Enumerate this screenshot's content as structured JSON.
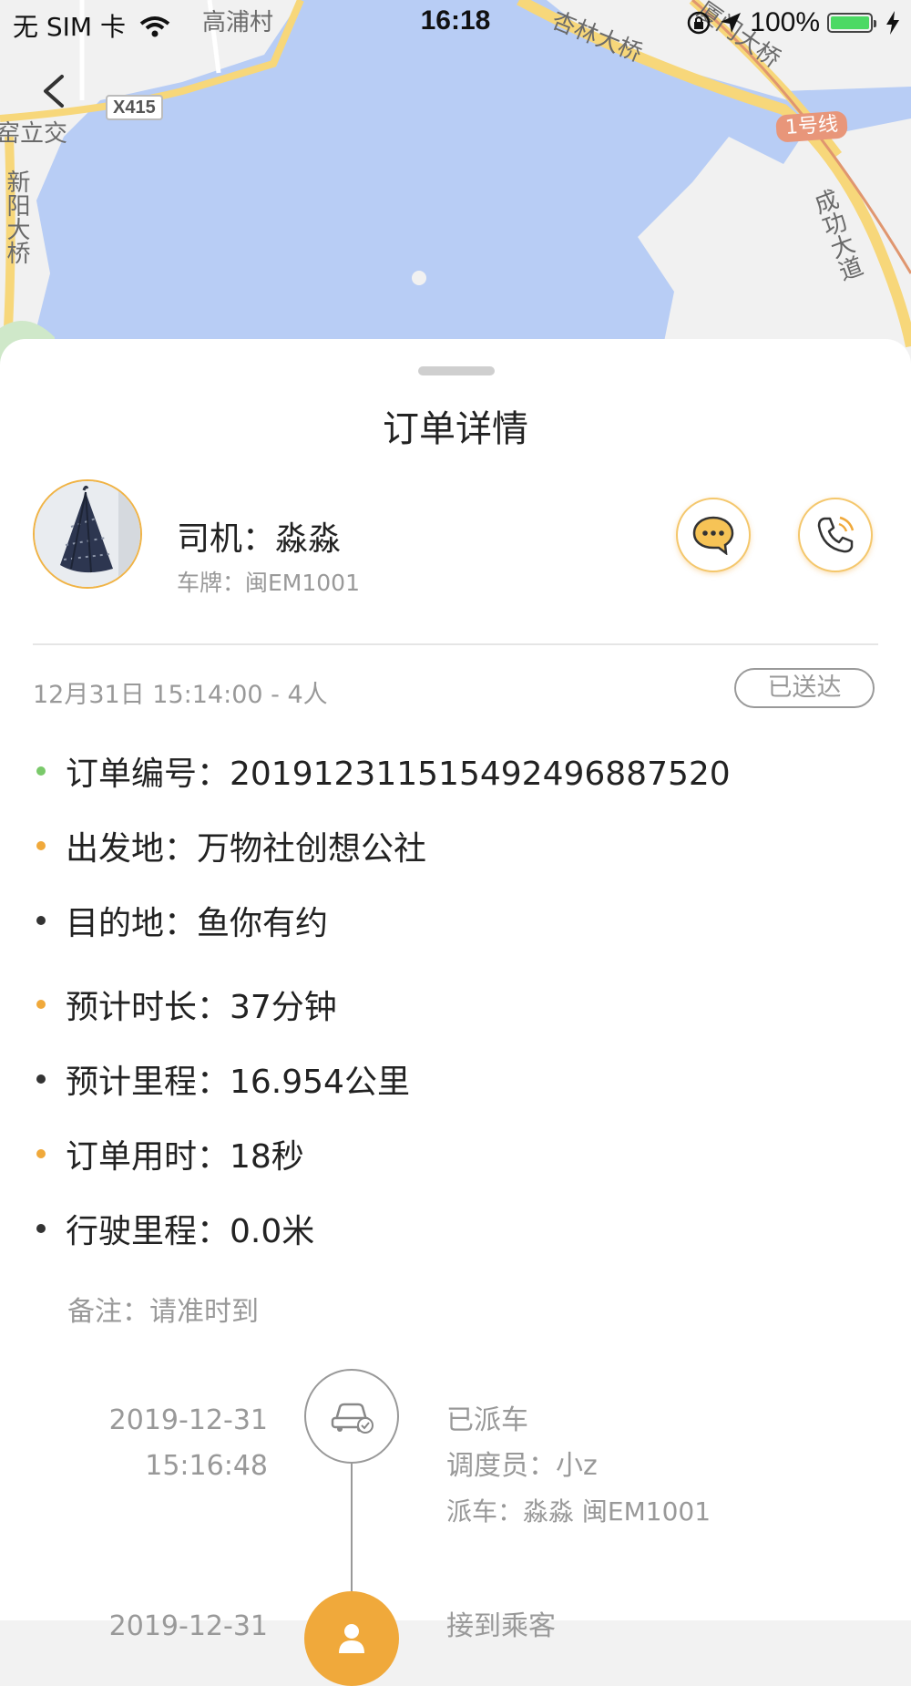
{
  "status_bar": {
    "carrier": "无 SIM 卡",
    "time": "16:18",
    "battery": "100%",
    "battery_level": 1.0
  },
  "map": {
    "labels": [
      "高浦村",
      "杏林大桥",
      "厦门大桥",
      "X415",
      "1号线",
      "成功大道",
      "新阳大桥",
      "窑立交"
    ],
    "colors": {
      "water": "#b8cdf5",
      "land": "#f1f1f1",
      "road": "#f7d77a"
    }
  },
  "sheet": {
    "title": "订单详情",
    "driver": {
      "name": "司机：淼淼",
      "plate": "车牌：闽EM1001",
      "avatar_icon": "umbrella-photo"
    },
    "actions": {
      "chat_icon": "chat-bubble-icon",
      "call_icon": "phone-icon"
    },
    "order_time": "12月31日 15:14:00 - 4人",
    "status": "已送达",
    "items": [
      {
        "text": "订单编号：201912311515492496887520",
        "dot_color": "#7ac96a"
      },
      {
        "text": "出发地：万物社创想公社",
        "dot_color": "#f0a93b"
      },
      {
        "text": "目的地：鱼你有约",
        "dot_color": "#333333"
      },
      {
        "text": "预计时长：37分钟",
        "dot_color": "#f0a93b"
      },
      {
        "text": "预计里程：16.954公里",
        "dot_color": "#333333"
      },
      {
        "text": "订单用时：18秒",
        "dot_color": "#f0a93b"
      },
      {
        "text": "行驶里程：0.0米",
        "dot_color": "#333333"
      }
    ],
    "remark": "备注：请准时到",
    "timeline": [
      {
        "date": "2019-12-31",
        "time": "15:16:48",
        "title": "已派车",
        "lines": [
          "调度员：小z",
          "派车：淼淼 闽EM1001"
        ],
        "icon": "car-check-icon"
      },
      {
        "date": "2019-12-31",
        "time": "",
        "title": "接到乘客",
        "lines": [],
        "icon": "passenger-icon",
        "accent": "#f0a93b"
      }
    ],
    "accent_color": "#f0a93b"
  }
}
